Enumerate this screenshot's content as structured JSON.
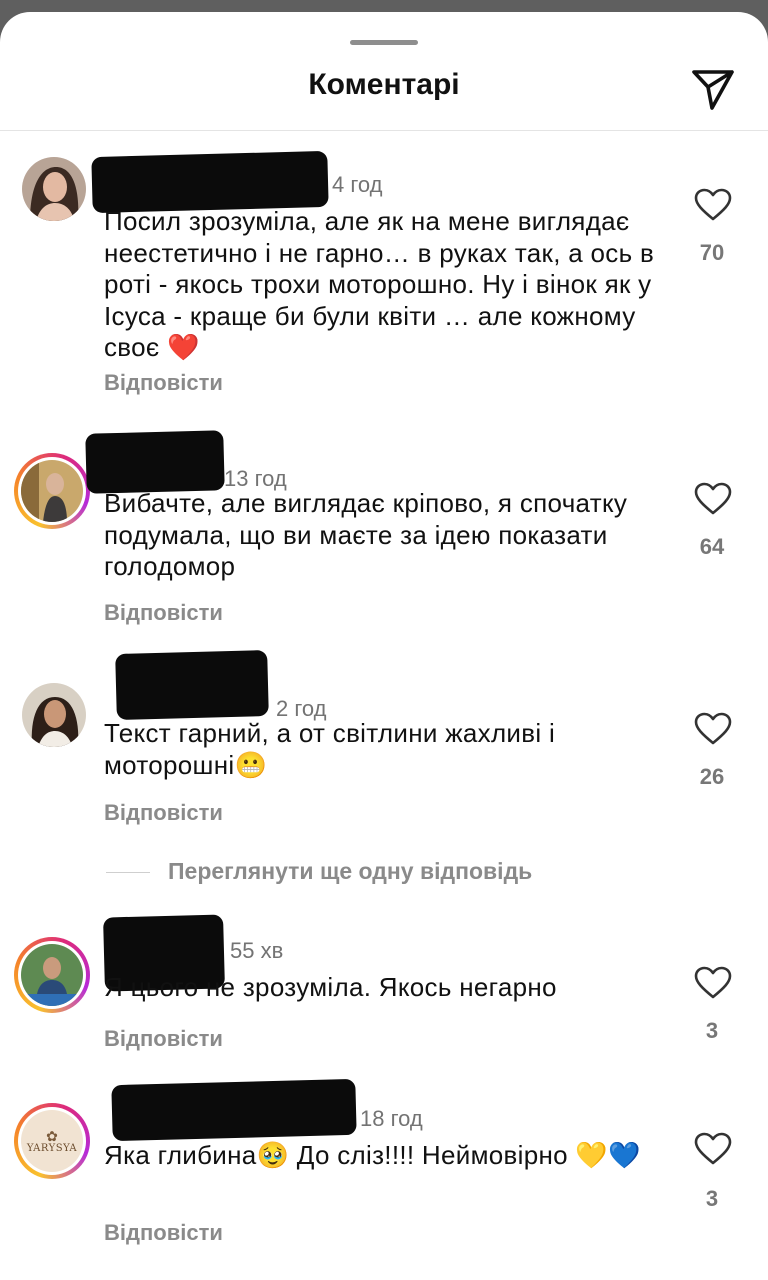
{
  "header": {
    "title": "Коментарі"
  },
  "comments": [
    {
      "time": "4 год",
      "text": "Посил зрозуміла, але як на мене виглядає неестетично і не гарно… в руках так, а ось в роті - якось трохи моторошно. Ну і вінок як у Ісуса - краще би були квіти … але кожному своє ❤️",
      "likes": "70",
      "reply": "Відповісти"
    },
    {
      "time": "13 год",
      "text": "Вибачте, але виглядає кріпово, я спочатку подумала, що ви маєте за ідею показати голодомор",
      "likes": "64",
      "reply": "Відповісти"
    },
    {
      "time": "2 год",
      "text": "Текст гарний, а от світлини жахливі і моторошні😬",
      "likes": "26",
      "reply": "Відповісти"
    },
    {
      "time": "55 хв",
      "text": "Я цього не зрозуміла. Якось негарно",
      "likes": "3",
      "reply": "Відповісти"
    },
    {
      "time": "18 год",
      "text": "Яка глибина🥹 До сліз!!!! Неймовірно 💛💙",
      "likes": "3",
      "reply": "Відповісти",
      "avatar_label": "YARYSYA"
    }
  ],
  "more_replies": "Переглянути ще одну відповідь",
  "colors": {
    "ring_gradient": [
      "#f9c12e",
      "#f58529",
      "#dd2a7b",
      "#b62ad8"
    ],
    "redaction": "#0b0b0b"
  }
}
